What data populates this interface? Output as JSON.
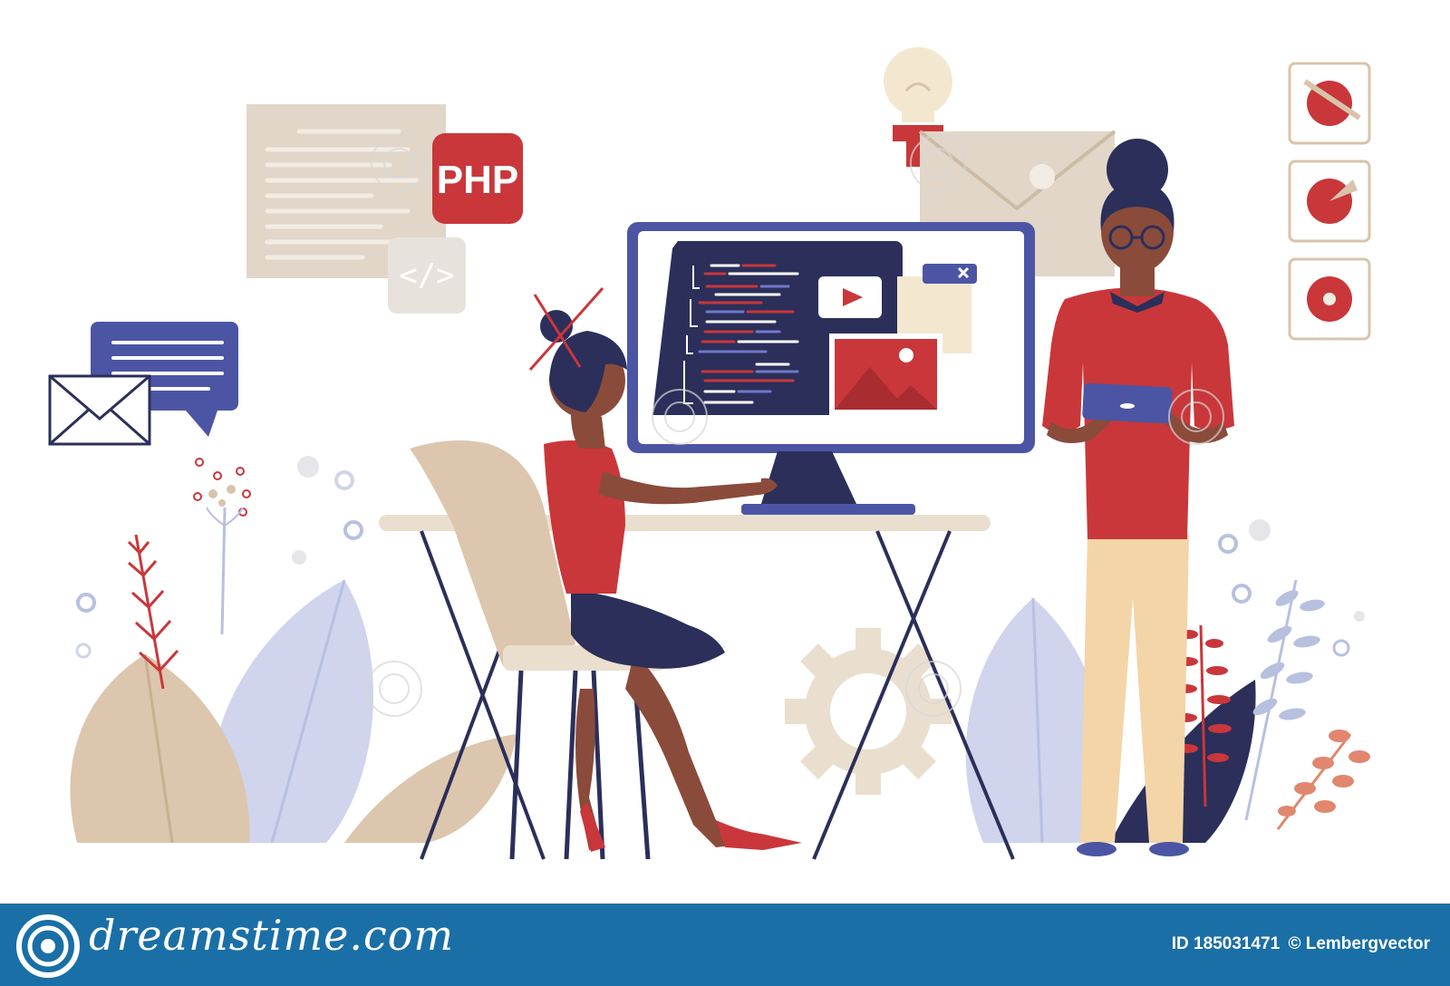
{
  "badges": {
    "php_label": "PHP",
    "code_tag": "</>"
  },
  "footer": {
    "brand": "dreamstime.com",
    "id_label": "ID 185031471",
    "credit": "© Lembergvector"
  },
  "colors": {
    "red": "#c9373a",
    "navy": "#2b2f5a",
    "beige": "#d8c4aa",
    "lavender": "#b8c0e0",
    "footer_blue": "#1a6fa7",
    "skin": "#8a4b3b"
  },
  "icons": [
    "envelope-icon",
    "chat-bubble-icon",
    "lightbulb-icon",
    "gear-icon",
    "play-icon",
    "image-icon",
    "close-icon",
    "pie-chart-icon"
  ]
}
